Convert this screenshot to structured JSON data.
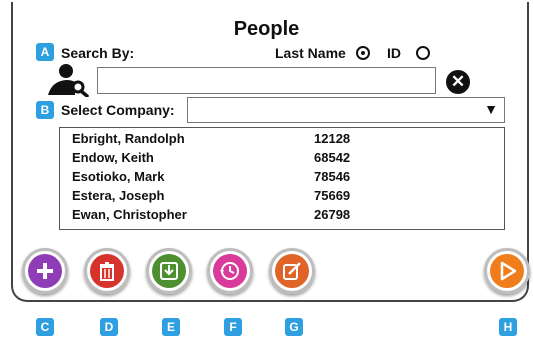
{
  "title": "People",
  "badges": {
    "a": "A",
    "b": "B",
    "c": "C",
    "d": "D",
    "e": "E",
    "f": "F",
    "g": "G",
    "h": "H"
  },
  "search": {
    "label": "Search By:",
    "option_last_name": "Last Name",
    "option_id": "ID",
    "selected": "Last Name",
    "value": "",
    "icon": "person-search-icon"
  },
  "company": {
    "label": "Select Company:",
    "value": ""
  },
  "people": [
    {
      "name": "Ebright, Randolph",
      "id": "12128"
    },
    {
      "name": "Endow, Keith",
      "id": "68542"
    },
    {
      "name": "Esotioko, Mark",
      "id": "78546"
    },
    {
      "name": "Estera, Joseph",
      "id": "75669"
    },
    {
      "name": "Ewan, Christopher",
      "id": "26798"
    }
  ],
  "buttons": [
    {
      "icon": "plus-icon",
      "color": "#8e3db6"
    },
    {
      "icon": "trash-icon",
      "color": "#d6332d"
    },
    {
      "icon": "download-icon",
      "color": "#4e8f2f"
    },
    {
      "icon": "history-icon",
      "color": "#d93b9a"
    },
    {
      "icon": "edit-icon",
      "color": "#e06327"
    },
    {
      "icon": "play-icon",
      "color": "#f07d1c"
    }
  ]
}
